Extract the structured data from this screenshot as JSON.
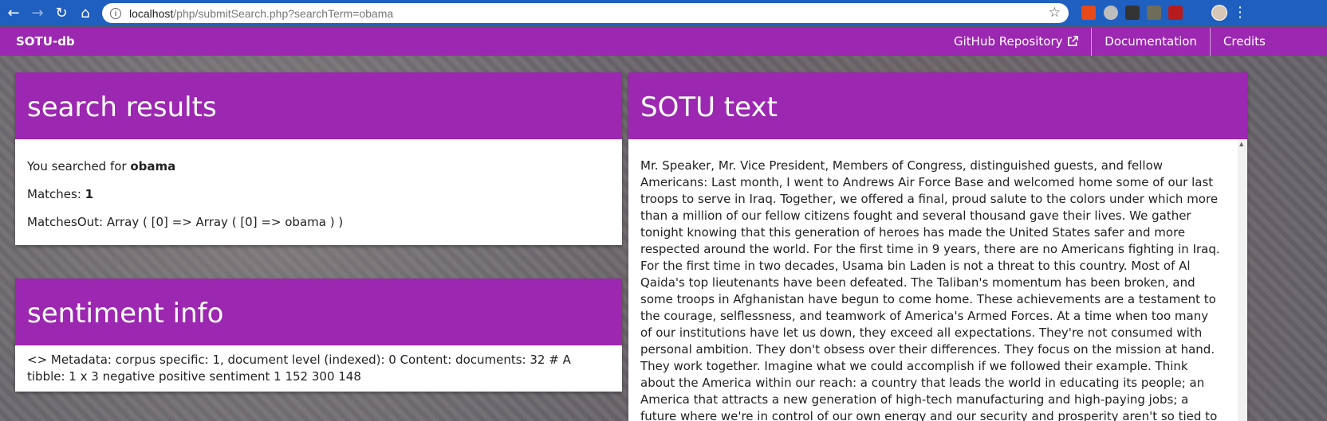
{
  "browser": {
    "url_host": "localhost",
    "url_path": "/php/submitSearch.php?searchTerm=obama"
  },
  "navbar": {
    "brand": "SOTU-db",
    "links": [
      "GitHub Repository",
      "Documentation",
      "Credits"
    ]
  },
  "search_results": {
    "title": "search results",
    "searched_prefix": "You searched for ",
    "search_term": "obama",
    "matches_label": "Matches: ",
    "matches_value": "1",
    "matches_out": "MatchesOut: Array ( [0] => Array ( [0] => obama ) )"
  },
  "sentiment": {
    "title": "sentiment info",
    "text": "<> Metadata: corpus specific: 1, document level (indexed): 0 Content: documents: 32 # A tibble: 1 x 3 negative positive sentiment 1 152 300 148"
  },
  "sotu": {
    "title": "SOTU text",
    "text": "Mr. Speaker, Mr. Vice President, Members of Congress, distinguished guests, and fellow Americans: Last month, I went to Andrews Air Force Base and welcomed home some of our last troops to serve in Iraq. Together, we offered a final, proud salute to the colors under which more than a million of our fellow citizens fought and several thousand gave their lives. We gather tonight knowing that this generation of heroes has made the United States safer and more respected around the world. For the first time in 9 years, there are no Americans fighting in Iraq. For the first time in two decades, Usama bin Laden is not a threat to this country. Most of Al Qaida's top lieutenants have been defeated. The Taliban's momentum has been broken, and some troops in Afghanistan have begun to come home. These achievements are a testament to the courage, selflessness, and teamwork of America's Armed Forces. At a time when too many of our institutions have let us down, they exceed all expectations. They're not consumed with personal ambition. They don't obsess over their differences. They focus on the mission at hand. They work together. Imagine what we could accomplish if we followed their example. Think about the America within our reach: a country that leads the world in educating its people; an America that attracts a new generation of high-tech manufacturing and high-paying jobs; a future where we're in control of our own energy and our security and prosperity aren't so tied to"
  }
}
